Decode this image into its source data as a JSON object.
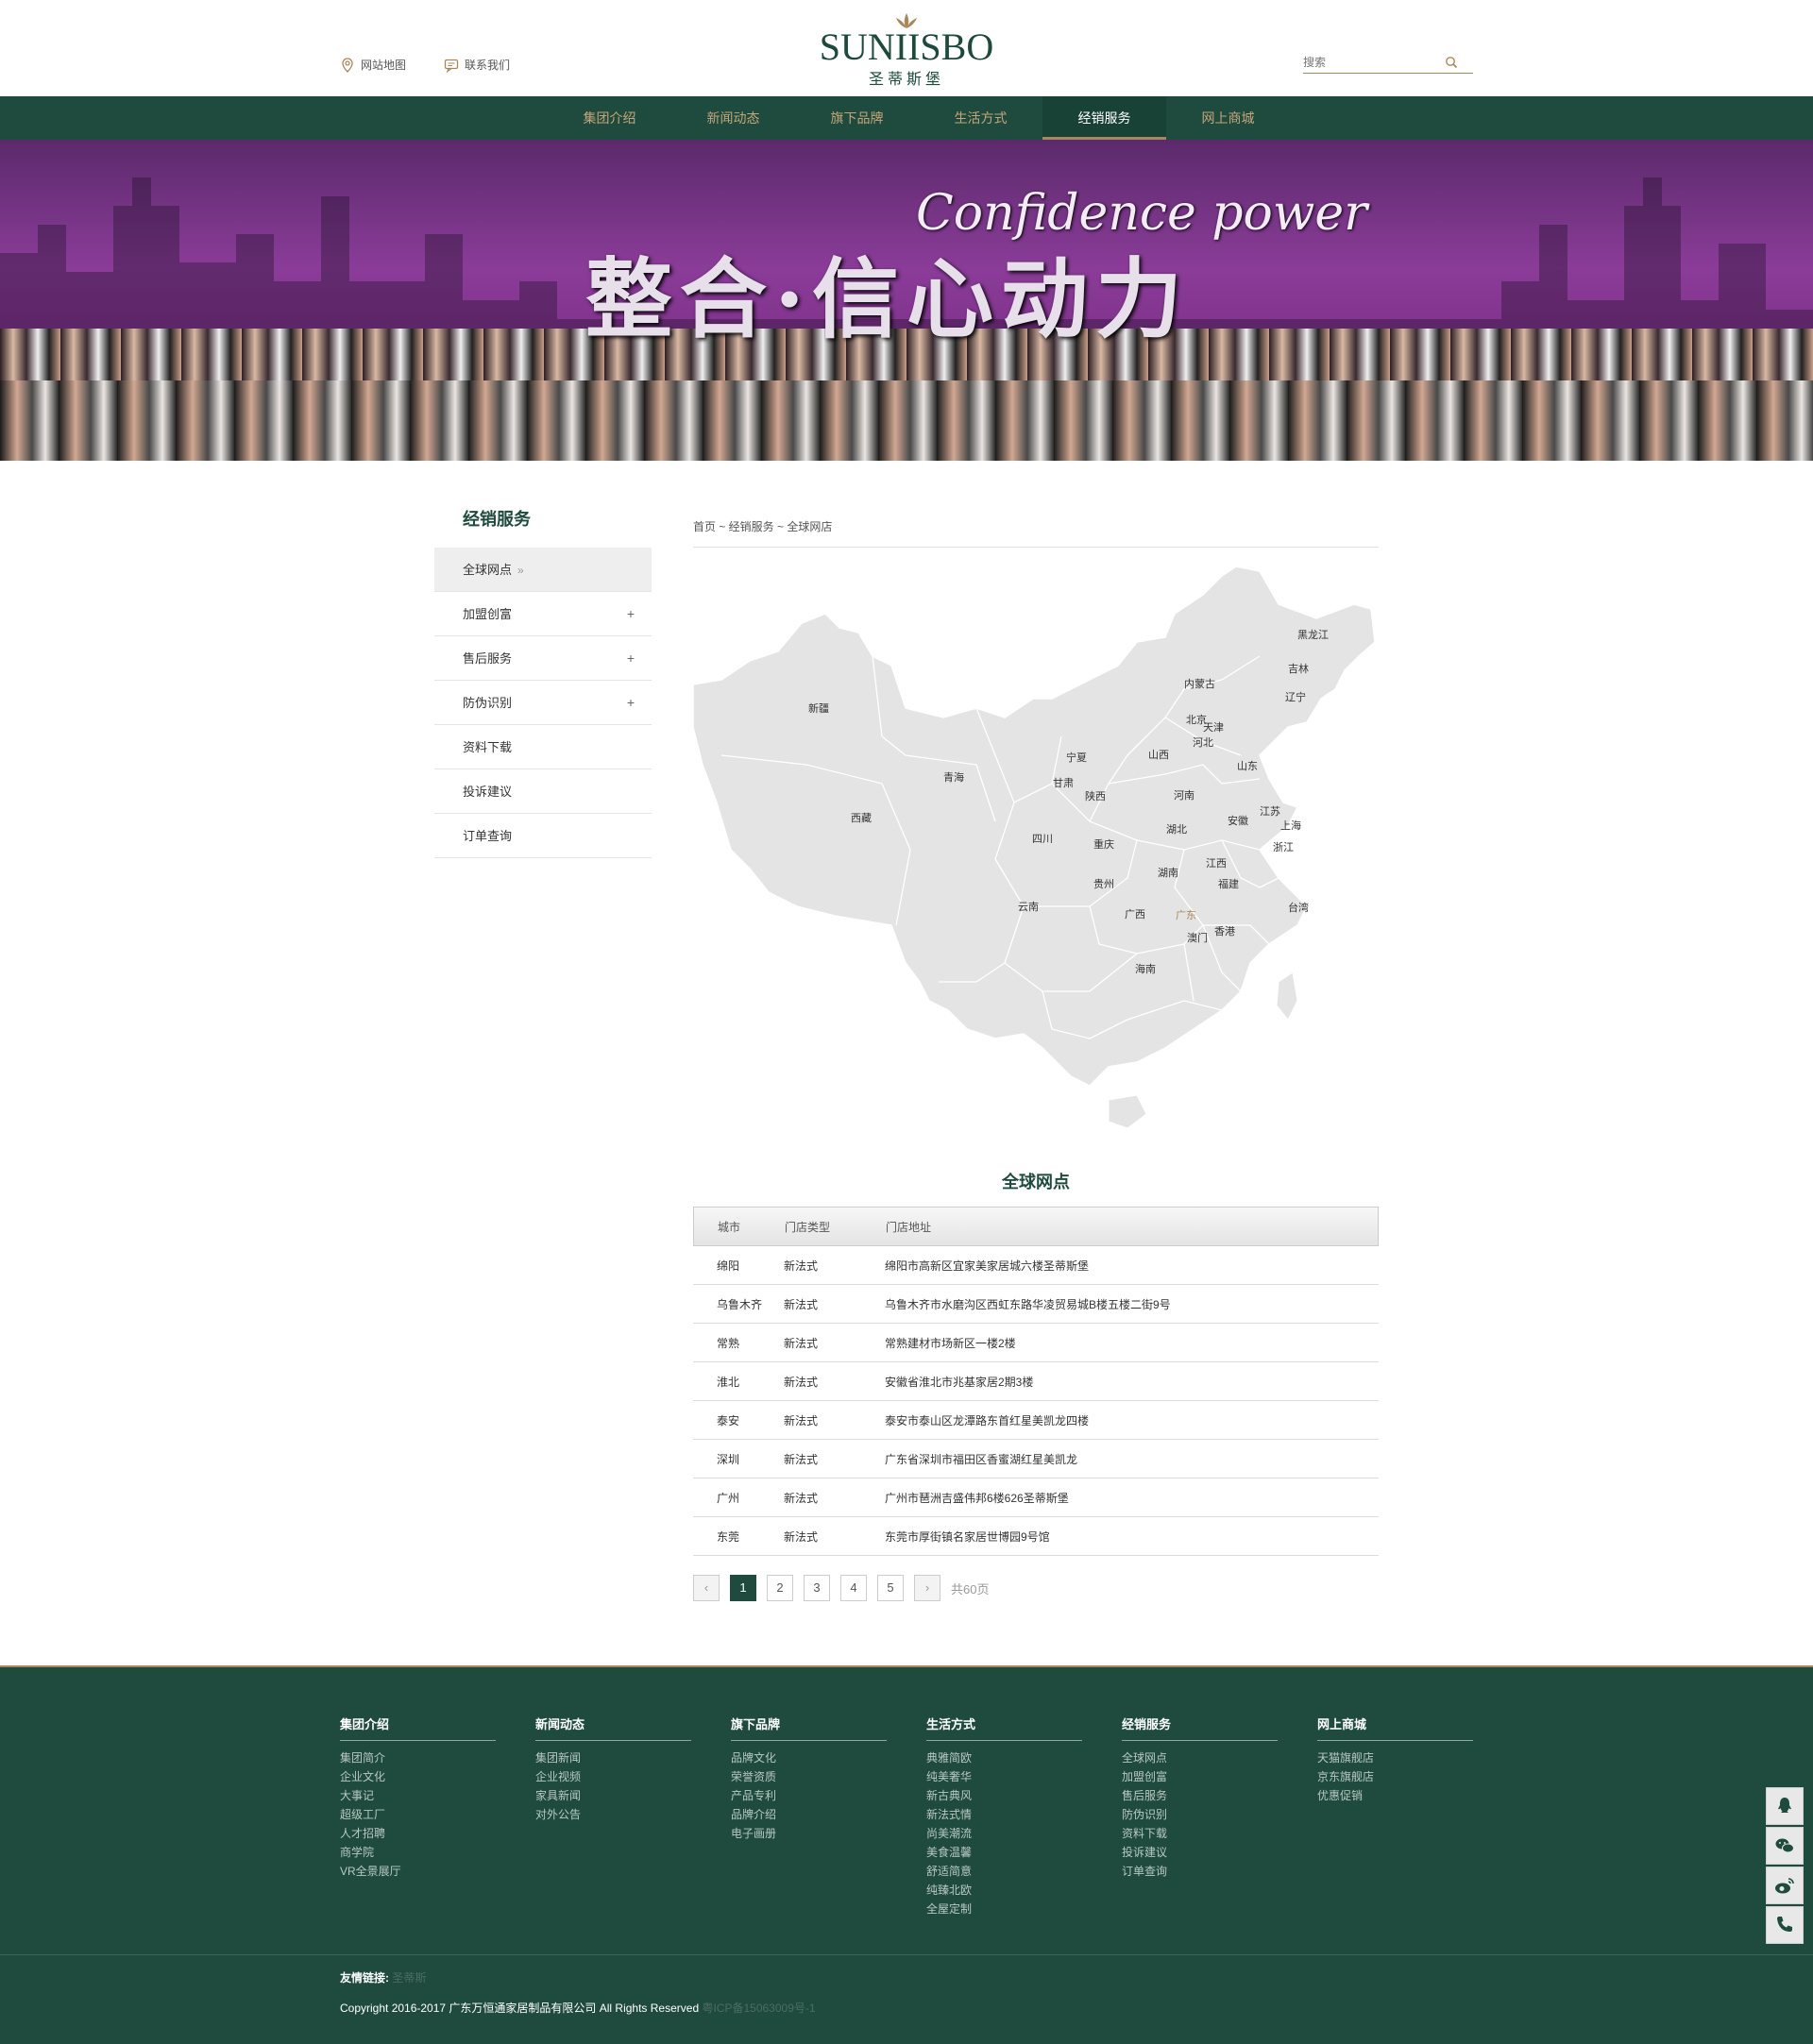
{
  "header": {
    "sitemap_label": "网站地图",
    "contact_label": "联系我们",
    "logo_en": "SUNIISBO",
    "logo_cn": "圣蒂斯堡",
    "search_placeholder": "搜索"
  },
  "nav": [
    "集团介绍",
    "新闻动态",
    "旗下品牌",
    "生活方式",
    "经销服务",
    "网上商城"
  ],
  "nav_active": "经销服务",
  "banner": {
    "headline": "整合·信心动力",
    "subtitle": "Confidence power"
  },
  "sidebar": {
    "title": "经销服务",
    "items": [
      {
        "label": "全球网点",
        "expand": "»"
      },
      {
        "label": "加盟创富",
        "expand": "+"
      },
      {
        "label": "售后服务",
        "expand": "+"
      },
      {
        "label": "防伪识别",
        "expand": "+"
      },
      {
        "label": "资料下载",
        "expand": ""
      },
      {
        "label": "投诉建议",
        "expand": ""
      },
      {
        "label": "订单查询",
        "expand": ""
      }
    ]
  },
  "breadcrumb": "首页 ~ 经销服务 ~ 全球网店",
  "map_provinces": [
    "黑龙江",
    "吉林",
    "辽宁",
    "内蒙古",
    "北京",
    "天津",
    "河北",
    "新疆",
    "宁夏",
    "山西",
    "山东",
    "青海",
    "甘肃",
    "陕西",
    "河南",
    "江苏",
    "上海",
    "西藏",
    "安徽",
    "湖北",
    "四川",
    "重庆",
    "浙江",
    "江西",
    "湖南",
    "贵州",
    "福建",
    "台湾",
    "云南",
    "广西",
    "广东",
    "香港",
    "澳门",
    "海南"
  ],
  "map_highlight": "广东",
  "section_title": "全球网点",
  "table": {
    "headers": [
      "城市",
      "门店类型",
      "门店地址"
    ],
    "rows": [
      [
        "绵阳",
        "新法式",
        "绵阳市高新区宜家美家居城六楼圣蒂斯堡"
      ],
      [
        "乌鲁木齐",
        "新法式",
        "乌鲁木齐市水磨沟区西虹东路华凌贸易城B楼五楼二街9号"
      ],
      [
        "常熟",
        "新法式",
        "常熟建材市场新区一楼2楼"
      ],
      [
        "淮北",
        "新法式",
        "安徽省淮北市兆基家居2期3楼"
      ],
      [
        "泰安",
        "新法式",
        "泰安市泰山区龙潭路东首红星美凯龙四楼"
      ],
      [
        "深圳",
        "新法式",
        "广东省深圳市福田区香蜜湖红星美凯龙"
      ],
      [
        "广州",
        "新法式",
        "广州市琶洲吉盛伟邦6楼626圣蒂斯堡"
      ],
      [
        "东莞",
        "新法式",
        "东莞市厚街镇名家居世博园9号馆"
      ]
    ]
  },
  "pager": {
    "prev": "‹",
    "pages": [
      "1",
      "2",
      "3",
      "4",
      "5"
    ],
    "current": "1",
    "next": "›",
    "total": "共60页"
  },
  "footer": {
    "columns": [
      {
        "title": "集团介绍",
        "links": [
          "集团简介",
          "企业文化",
          "大事记",
          "超级工厂",
          "人才招聘",
          "商学院",
          "VR全景展厅"
        ]
      },
      {
        "title": "新闻动态",
        "links": [
          "集团新闻",
          "企业视频",
          "家具新闻",
          "对外公告"
        ]
      },
      {
        "title": "旗下品牌",
        "links": [
          "品牌文化",
          "荣誉资质",
          "产品专利",
          "品牌介绍",
          "电子画册"
        ]
      },
      {
        "title": "生活方式",
        "links": [
          "典雅简欧",
          "纯美奢华",
          "新古典风",
          "新法式情",
          "尚美潮流",
          "美食温馨",
          "舒适简意",
          "纯臻北欧",
          "全屋定制"
        ]
      },
      {
        "title": "经销服务",
        "links": [
          "全球网点",
          "加盟创富",
          "售后服务",
          "防伪识别",
          "资料下载",
          "投诉建议",
          "订单查询"
        ]
      },
      {
        "title": "网上商城",
        "links": [
          "天猫旗舰店",
          "京东旗舰店",
          "优惠促销"
        ]
      }
    ],
    "friend_links_label": "友情链接:",
    "friend_link": "圣蒂斯",
    "copyright": "Copyright  2016-2017  广东万恒通家居制品有限公司  All Rights Reserved",
    "icp": "粤ICP备15063009号-1"
  },
  "colors": {
    "primary": "#1f4b3e",
    "accent": "#a9875a",
    "map_fill": "#e4e4e4",
    "map_highlight_text": "#a9875a"
  },
  "float_icons": [
    "qq-icon",
    "wechat-icon",
    "weibo-icon",
    "phone-icon"
  ]
}
